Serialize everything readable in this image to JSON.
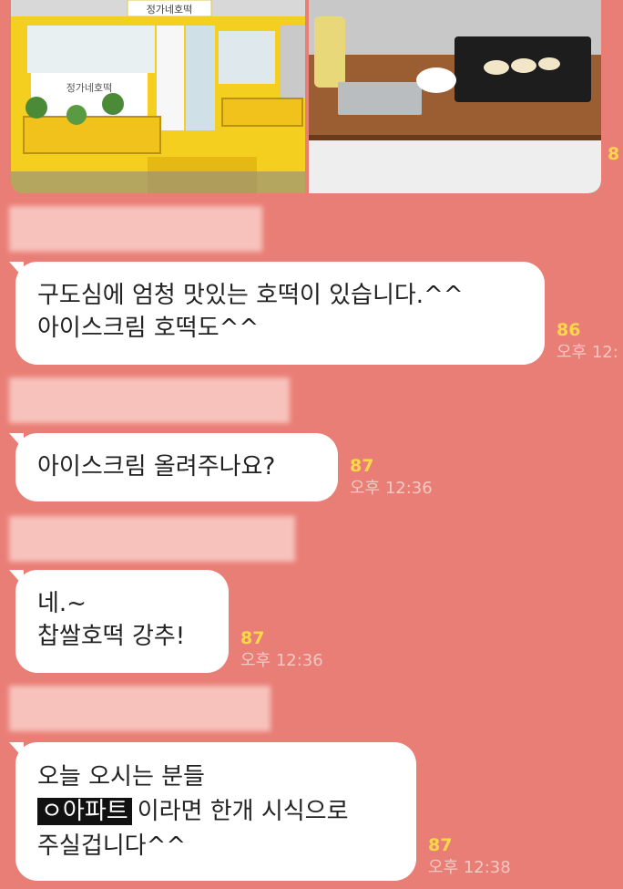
{
  "header_photos": {
    "store_sign": "정가네호떡",
    "cut_read_count": "8"
  },
  "messages": [
    {
      "lines": [
        "구도심에 엄청 맛있는 호떡이 있습니다.^^",
        "아이스크림 호떡도^^"
      ],
      "read_count": "86",
      "time": "오후 12:"
    },
    {
      "lines": [
        "아이스크림 올려주나요?"
      ],
      "read_count": "87",
      "time": "오후 12:36"
    },
    {
      "lines": [
        "네.~",
        "찹쌀호떡 강추!"
      ],
      "read_count": "87",
      "time": "오후 12:36"
    },
    {
      "lines": [
        "오늘 오시는 분들",
        "이라면 한개 시식으로",
        "주실겁니다^^"
      ],
      "highlight": "ㅇ아파트",
      "read_count": "87",
      "time": "오후 12:38"
    }
  ],
  "colors": {
    "background": "#e97e76",
    "bubble": "#ffffff",
    "read_count": "#ffd84a"
  }
}
